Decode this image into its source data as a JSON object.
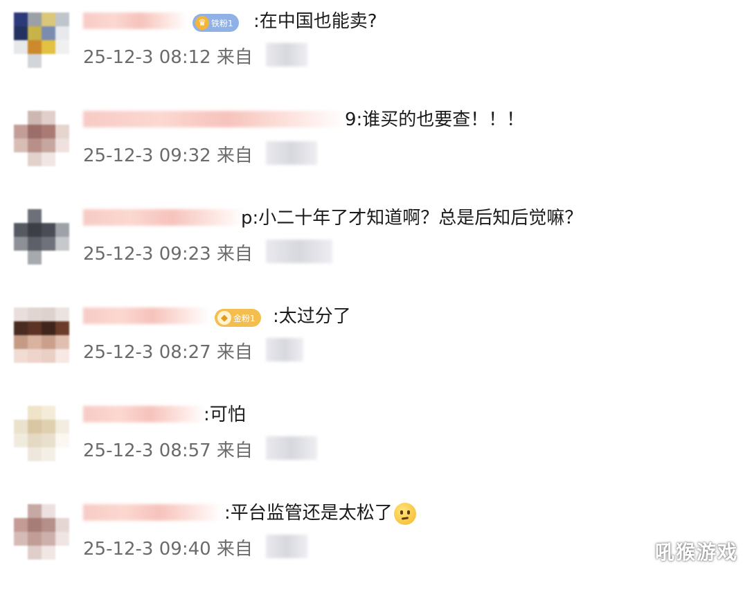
{
  "comments": [
    {
      "text": ":在中国也能卖?",
      "meta": "25-12-3 08:12 来自",
      "badge": "铁粉1"
    },
    {
      "text": "9:谁买的也要查！！！",
      "meta": "25-12-3 09:32 来自"
    },
    {
      "text": "p:小二十年了才知道啊？总是后知后觉嘛？",
      "meta": "25-12-3 09:23 来自"
    },
    {
      "text": ":太过分了",
      "meta": "25-12-3 08:27 来自",
      "badge": "金粉1"
    },
    {
      "text": ":可怕",
      "meta": "25-12-3 08:57 来自"
    },
    {
      "text": ":平台监管还是太松了",
      "meta": "25-12-3 09:40 来自",
      "emoji": "thinking-face-icon"
    }
  ],
  "watermark": "吼猴游戏",
  "colors": {
    "text": "#1a1a1a",
    "meta": "#6b6b6b",
    "badge_tie": "#7ea6e0",
    "badge_jin": "#f0b43c"
  }
}
